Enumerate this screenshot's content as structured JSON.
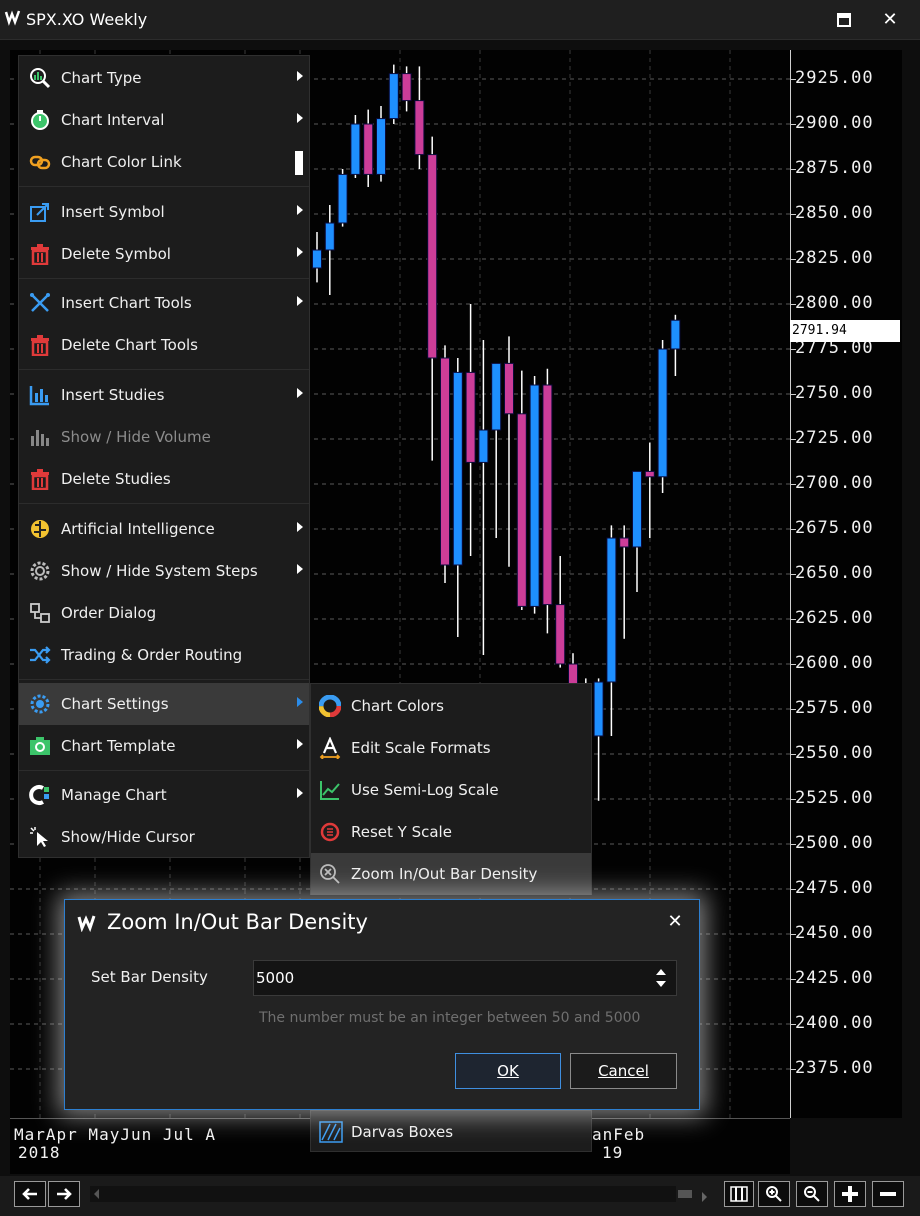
{
  "window": {
    "title": "SPX.XO Weekly",
    "maximize_icon": "maximize-icon",
    "close_icon": "close-icon"
  },
  "y_axis": {
    "labels": [
      "2925.00",
      "2900.00",
      "2875.00",
      "2850.00",
      "2825.00",
      "2800.00",
      "2775.00",
      "2750.00",
      "2725.00",
      "2700.00",
      "2675.00",
      "2650.00",
      "2625.00",
      "2600.00",
      "2575.00",
      "2550.00",
      "2525.00",
      "2500.00",
      "2475.00",
      "2450.00",
      "2425.00",
      "2400.00",
      "2375.00"
    ],
    "current_price": "2791.94"
  },
  "x_axis": {
    "months_left": "MarApr MayJun Jul  A",
    "year_left": "2018",
    "months_right": "anFeb",
    "year_right": "19"
  },
  "menu": {
    "items": [
      {
        "label": "Chart Type",
        "icon": "chart-type-icon",
        "submenu": true
      },
      {
        "label": "Chart Interval",
        "icon": "chart-interval-icon",
        "submenu": true
      },
      {
        "label": "Chart Color Link",
        "icon": "color-link-icon",
        "submenu": false
      },
      {
        "label": "Insert Symbol",
        "icon": "insert-symbol-icon",
        "submenu": true
      },
      {
        "label": "Delete Symbol",
        "icon": "trash-icon",
        "submenu": true
      },
      {
        "label": "Insert Chart Tools",
        "icon": "chart-tools-icon",
        "submenu": true
      },
      {
        "label": "Delete Chart Tools",
        "icon": "trash-icon",
        "submenu": false
      },
      {
        "label": "Insert Studies",
        "icon": "studies-icon",
        "submenu": true
      },
      {
        "label": "Show / Hide Volume",
        "icon": "volume-icon",
        "submenu": false,
        "disabled": true
      },
      {
        "label": "Delete Studies",
        "icon": "trash-icon",
        "submenu": false
      },
      {
        "label": "Artificial Intelligence",
        "icon": "ai-brain-icon",
        "submenu": true
      },
      {
        "label": "Show / Hide System Steps",
        "icon": "system-steps-icon",
        "submenu": true
      },
      {
        "label": "Order Dialog",
        "icon": "order-dialog-icon",
        "submenu": false
      },
      {
        "label": "Trading & Order Routing",
        "icon": "order-routing-icon",
        "submenu": false
      },
      {
        "label": "Chart Settings",
        "icon": "chart-settings-gear-icon",
        "submenu": true,
        "active": true
      },
      {
        "label": "Chart Template",
        "icon": "chart-template-icon",
        "submenu": true
      },
      {
        "label": "Manage Chart",
        "icon": "manage-chart-icon",
        "submenu": true
      },
      {
        "label": "Show/Hide Cursor",
        "icon": "cursor-icon",
        "submenu": false
      }
    ]
  },
  "submenu": {
    "items": [
      {
        "label": "Chart Colors",
        "icon": "color-wheel-icon"
      },
      {
        "label": "Edit Scale Formats",
        "icon": "edit-scale-icon"
      },
      {
        "label": "Use Semi-Log Scale",
        "icon": "semi-log-icon"
      },
      {
        "label": "Reset Y Scale",
        "icon": "reset-scale-icon"
      },
      {
        "label": "Zoom In/Out Bar Density",
        "icon": "zoom-density-icon",
        "highlighted": true
      }
    ],
    "darvas_label": "Darvas Boxes"
  },
  "dialog": {
    "title": "Zoom In/Out Bar Density",
    "field_label": "Set Bar Density",
    "field_value": "5000",
    "hint": "The number must be an integer between 50 and 5000",
    "ok_label": "OK",
    "cancel_label": "Cancel"
  },
  "bottom_toolbar": {
    "back_icon": "arrow-left-icon",
    "forward_icon": "arrow-right-icon",
    "zoom_in_icon": "zoom-in-icon",
    "zoom_out_icon": "zoom-out-icon",
    "plus_icon": "plus-icon",
    "minus_icon": "minus-icon"
  },
  "colors": {
    "bull": "#1e8fff",
    "bear": "#cc3d99",
    "wick": "#ffffff",
    "dialog_border": "#2d7fd0"
  },
  "candles": [
    {
      "o": 2820,
      "h": 2840,
      "l": 2812,
      "c": 2830
    },
    {
      "o": 2830,
      "h": 2855,
      "l": 2805,
      "c": 2845
    },
    {
      "o": 2845,
      "h": 2875,
      "l": 2843,
      "c": 2872
    },
    {
      "o": 2872,
      "h": 2905,
      "l": 2870,
      "c": 2900
    },
    {
      "o": 2900,
      "h": 2908,
      "l": 2865,
      "c": 2872
    },
    {
      "o": 2872,
      "h": 2910,
      "l": 2868,
      "c": 2903
    },
    {
      "o": 2903,
      "h": 2933,
      "l": 2900,
      "c": 2928
    },
    {
      "o": 2928,
      "h": 2932,
      "l": 2907,
      "c": 2913
    },
    {
      "o": 2913,
      "h": 2932,
      "l": 2875,
      "c": 2883
    },
    {
      "o": 2883,
      "h": 2893,
      "l": 2713,
      "c": 2770
    },
    {
      "o": 2770,
      "h": 2777,
      "l": 2645,
      "c": 2655
    },
    {
      "o": 2655,
      "h": 2770,
      "l": 2615,
      "c": 2762
    },
    {
      "o": 2762,
      "h": 2800,
      "l": 2660,
      "c": 2712
    },
    {
      "o": 2712,
      "h": 2780,
      "l": 2605,
      "c": 2730
    },
    {
      "o": 2730,
      "h": 2760,
      "l": 2670,
      "c": 2767
    },
    {
      "o": 2767,
      "h": 2782,
      "l": 2654,
      "c": 2739
    },
    {
      "o": 2739,
      "h": 2763,
      "l": 2630,
      "c": 2632
    },
    {
      "o": 2632,
      "h": 2760,
      "l": 2628,
      "c": 2755
    },
    {
      "o": 2755,
      "h": 2764,
      "l": 2617,
      "c": 2633
    },
    {
      "o": 2633,
      "h": 2660,
      "l": 2598,
      "c": 2600
    },
    {
      "o": 2600,
      "h": 2606,
      "l": 2555,
      "c": 2585
    },
    {
      "o": 2585,
      "h": 2592,
      "l": 2532,
      "c": 2560
    },
    {
      "o": 2560,
      "h": 2592,
      "l": 2524,
      "c": 2590
    },
    {
      "o": 2590,
      "h": 2677,
      "l": 2560,
      "c": 2670
    },
    {
      "o": 2670,
      "h": 2677,
      "l": 2614,
      "c": 2665
    },
    {
      "o": 2665,
      "h": 2701,
      "l": 2640,
      "c": 2707
    },
    {
      "o": 2707,
      "h": 2723,
      "l": 2670,
      "c": 2704
    },
    {
      "o": 2704,
      "h": 2780,
      "l": 2695,
      "c": 2775
    },
    {
      "o": 2775,
      "h": 2794,
      "l": 2760,
      "c": 2791
    }
  ]
}
